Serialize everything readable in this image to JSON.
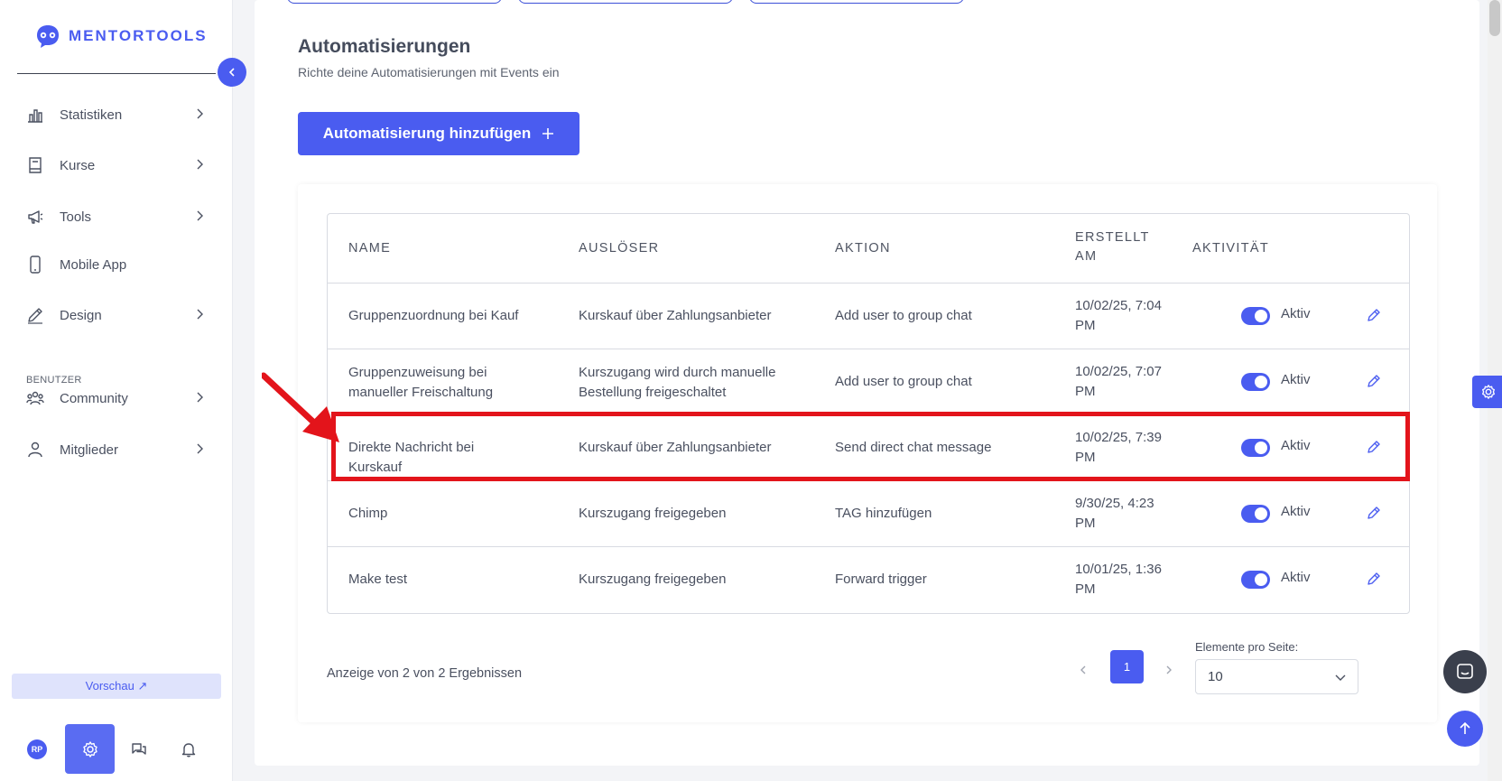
{
  "app": {
    "brand": "MENTORTOOLS",
    "accent_color": "#4a5cf0",
    "highlight_color": "#e3141b"
  },
  "sidebar": {
    "items": [
      {
        "label": "Statistiken",
        "icon": "bar-chart-icon",
        "has_chevron": true
      },
      {
        "label": "Kurse",
        "icon": "book-icon",
        "has_chevron": true
      },
      {
        "label": "Tools",
        "icon": "megaphone-icon",
        "has_chevron": true
      },
      {
        "label": "Mobile App",
        "icon": "phone-icon",
        "has_chevron": false
      },
      {
        "label": "Design",
        "icon": "pencil-icon",
        "has_chevron": true
      }
    ],
    "section_label": "BENUTZER",
    "user_items": [
      {
        "label": "Community",
        "icon": "group-icon",
        "has_chevron": true
      },
      {
        "label": "Mitglieder",
        "icon": "user-icon",
        "has_chevron": true
      }
    ],
    "preview_label": "Vorschau ↗",
    "avatar_initials": "RP"
  },
  "main": {
    "title": "Automatisierungen",
    "subtitle": "Richte deine Automatisierungen mit Events ein",
    "add_button_label": "Automatisierung hinzufügen",
    "table": {
      "headers": {
        "name": "NAME",
        "trigger": "AUSLÖSER",
        "action": "AKTION",
        "created": "ERSTELLT AM",
        "activity": "AKTIVITÄT"
      },
      "rows": [
        {
          "name": "Gruppenzuordnung bei Kauf",
          "trigger": "Kurskauf über Zahlungsanbieter",
          "action": "Add user to group chat",
          "created": "10/02/25, 7:04 PM",
          "status": "Aktiv",
          "active": true
        },
        {
          "name": "Gruppenzuweisung bei manueller Freischaltung",
          "trigger": "Kurszugang wird durch manuelle Bestellung freigeschaltet",
          "action": "Add user to group chat",
          "created": "10/02/25, 7:07 PM",
          "status": "Aktiv",
          "active": true
        },
        {
          "name": "Direkte Nachricht bei Kurskauf",
          "trigger": "Kurskauf über Zahlungsanbieter",
          "action": "Send direct chat message",
          "created": "10/02/25, 7:39 PM",
          "status": "Aktiv",
          "active": true
        },
        {
          "name": "Chimp",
          "trigger": "Kurszugang freigegeben",
          "action": "TAG hinzufügen",
          "created": "9/30/25, 4:23 PM",
          "status": "Aktiv",
          "active": true
        },
        {
          "name": "Make test",
          "trigger": "Kurszugang freigegeben",
          "action": "Forward trigger",
          "created": "10/01/25, 1:36 PM",
          "status": "Aktiv",
          "active": true
        }
      ]
    },
    "pagination": {
      "result_text": "Anzeige von 2 von 2 Ergebnissen",
      "current_page": "1",
      "per_page_label": "Elemente pro Seite:",
      "per_page_value": "10"
    }
  }
}
